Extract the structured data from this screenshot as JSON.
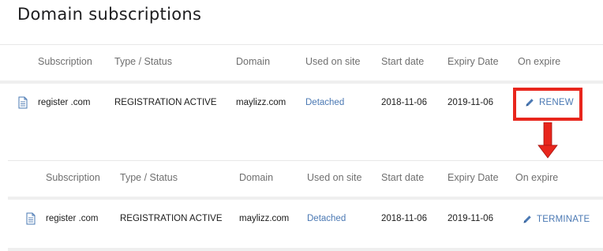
{
  "title": "Domain subscriptions",
  "columns": [
    "Subscription",
    "Type / Status",
    "Domain",
    "Used on site",
    "Start date",
    "Expiry Date",
    "On expire"
  ],
  "before": {
    "subscription": "register .com",
    "type_status": "REGISTRATION ACTIVE",
    "domain": "maylizz.com",
    "used_on_site": "Detached",
    "start_date": "2018-11-06",
    "expiry_date": "2019-11-06",
    "on_expire_action": "RENEW"
  },
  "after": {
    "subscription": "register .com",
    "type_status": "REGISTRATION ACTIVE",
    "domain": "maylizz.com",
    "used_on_site": "Detached",
    "start_date": "2018-11-06",
    "expiry_date": "2019-11-06",
    "on_expire_action": "TERMINATE"
  },
  "icons": {
    "subscription": "document-icon",
    "action": "pencil-icon",
    "annotation": "arrow-down-icon"
  },
  "colors": {
    "link": "#4a78b3",
    "annotation": "#e8261d"
  }
}
